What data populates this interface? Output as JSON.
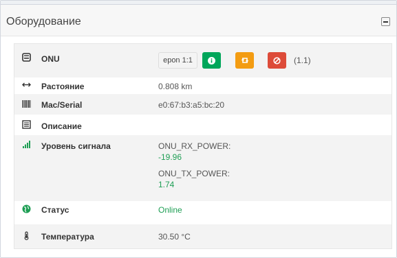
{
  "panel": {
    "title": "Оборудование"
  },
  "rows": {
    "onu": {
      "label": "ONU",
      "type_button": "epon 1:1",
      "index": "(1.1)"
    },
    "distance": {
      "label": "Растояние",
      "value": "0.808 km"
    },
    "mac": {
      "label": "Mac/Serial",
      "value": "e0:67:b3:a5:bc:20"
    },
    "description": {
      "label": "Описание",
      "value": ""
    },
    "signal": {
      "label": "Уровень сигнала",
      "rx_label": "ONU_RX_POWER:",
      "rx_value": "-19.96",
      "tx_label": "ONU_TX_POWER:",
      "tx_value": "1.74"
    },
    "status": {
      "label": "Статус",
      "value": "Online"
    },
    "temperature": {
      "label": "Температура",
      "value": "30.50 °C"
    }
  },
  "icons": {
    "onu": "hdd-icon",
    "distance": "arrows-horizontal-icon",
    "mac": "barcode-icon",
    "description": "list-alt-icon",
    "signal": "signal-bars-icon",
    "status": "globe-icon",
    "temperature": "thermometer-icon",
    "info": "info-icon",
    "reboot": "retweet-icon",
    "delete": "ban-icon"
  },
  "colors": {
    "green": "#00a65a",
    "orange": "#f39c12",
    "red": "#dd4b39",
    "status_text": "#1e9e54"
  }
}
